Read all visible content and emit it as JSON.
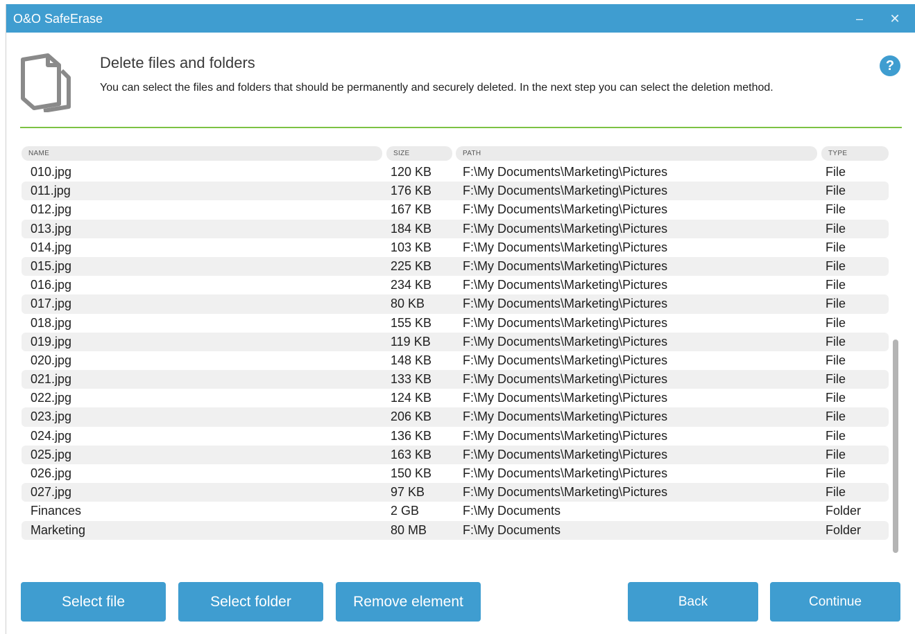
{
  "window": {
    "title": "O&O SafeErase",
    "minimize_glyph": "–",
    "close_glyph": "✕"
  },
  "header": {
    "icon": "files-icon",
    "title": "Delete files and folders",
    "description": "You can select the files and folders that should be permanently and securely deleted. In the next step you can select the deletion method.",
    "help_glyph": "?"
  },
  "table": {
    "columns": {
      "name": "NAME",
      "size": "SIZE",
      "path": "PATH",
      "type": "TYPE"
    },
    "rows": [
      {
        "name": "010.jpg",
        "size": "120 KB",
        "path": "F:\\My Documents\\Marketing\\Pictures",
        "type": "File"
      },
      {
        "name": "011.jpg",
        "size": "176 KB",
        "path": "F:\\My Documents\\Marketing\\Pictures",
        "type": "File"
      },
      {
        "name": "012.jpg",
        "size": "167 KB",
        "path": "F:\\My Documents\\Marketing\\Pictures",
        "type": "File"
      },
      {
        "name": "013.jpg",
        "size": "184 KB",
        "path": "F:\\My Documents\\Marketing\\Pictures",
        "type": "File"
      },
      {
        "name": "014.jpg",
        "size": "103 KB",
        "path": "F:\\My Documents\\Marketing\\Pictures",
        "type": "File"
      },
      {
        "name": "015.jpg",
        "size": "225 KB",
        "path": "F:\\My Documents\\Marketing\\Pictures",
        "type": "File"
      },
      {
        "name": "016.jpg",
        "size": "234 KB",
        "path": "F:\\My Documents\\Marketing\\Pictures",
        "type": "File"
      },
      {
        "name": "017.jpg",
        "size": "80 KB",
        "path": "F:\\My Documents\\Marketing\\Pictures",
        "type": "File"
      },
      {
        "name": "018.jpg",
        "size": "155 KB",
        "path": "F:\\My Documents\\Marketing\\Pictures",
        "type": "File"
      },
      {
        "name": "019.jpg",
        "size": "119 KB",
        "path": "F:\\My Documents\\Marketing\\Pictures",
        "type": "File"
      },
      {
        "name": "020.jpg",
        "size": "148 KB",
        "path": "F:\\My Documents\\Marketing\\Pictures",
        "type": "File"
      },
      {
        "name": "021.jpg",
        "size": "133 KB",
        "path": "F:\\My Documents\\Marketing\\Pictures",
        "type": "File"
      },
      {
        "name": "022.jpg",
        "size": "124 KB",
        "path": "F:\\My Documents\\Marketing\\Pictures",
        "type": "File"
      },
      {
        "name": "023.jpg",
        "size": "206 KB",
        "path": "F:\\My Documents\\Marketing\\Pictures",
        "type": "File"
      },
      {
        "name": "024.jpg",
        "size": "136 KB",
        "path": "F:\\My Documents\\Marketing\\Pictures",
        "type": "File"
      },
      {
        "name": "025.jpg",
        "size": "163 KB",
        "path": "F:\\My Documents\\Marketing\\Pictures",
        "type": "File"
      },
      {
        "name": "026.jpg",
        "size": "150 KB",
        "path": "F:\\My Documents\\Marketing\\Pictures",
        "type": "File"
      },
      {
        "name": "027.jpg",
        "size": "97 KB",
        "path": "F:\\My Documents\\Marketing\\Pictures",
        "type": "File"
      },
      {
        "name": "Finances",
        "size": "2 GB",
        "path": "F:\\My Documents",
        "type": "Folder"
      },
      {
        "name": "Marketing",
        "size": "80 MB",
        "path": "F:\\My Documents",
        "type": "Folder"
      }
    ]
  },
  "buttons": {
    "select_file": "Select file",
    "select_folder": "Select folder",
    "remove_element": "Remove element",
    "back": "Back",
    "continue": "Continue"
  },
  "colors": {
    "accent": "#3f9dd0",
    "divider": "#7cc243",
    "row_alt": "#f0f0f0",
    "header_bg": "#ebebeb"
  }
}
